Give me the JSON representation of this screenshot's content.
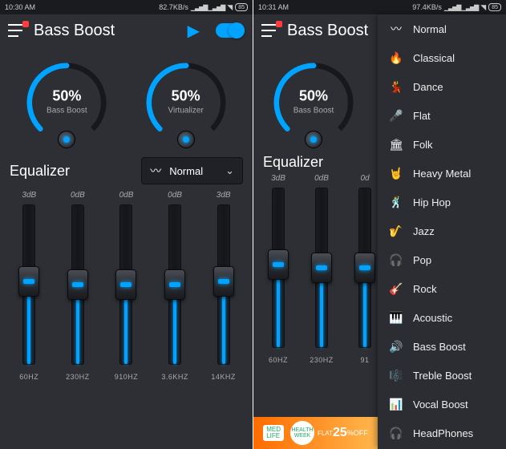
{
  "left": {
    "status": {
      "time": "10:30 AM",
      "net": "82.7KB/s",
      "battery": "85"
    },
    "title": "Bass Boost",
    "knobs": [
      {
        "percent": "50%",
        "label": "Bass Boost"
      },
      {
        "percent": "50%",
        "label": "Virtualizer"
      }
    ],
    "eq_title": "Equalizer",
    "preset_selected": "Normal",
    "bands": [
      {
        "db": "3dB",
        "freq": "60HZ",
        "pos": 52
      },
      {
        "db": "0dB",
        "freq": "230HZ",
        "pos": 50
      },
      {
        "db": "0dB",
        "freq": "910HZ",
        "pos": 50
      },
      {
        "db": "0dB",
        "freq": "3.6KHZ",
        "pos": 50
      },
      {
        "db": "3dB",
        "freq": "14KHZ",
        "pos": 52
      }
    ]
  },
  "right": {
    "status": {
      "time": "10:31 AM",
      "net": "97.4KB/s",
      "battery": "85"
    },
    "title": "Bass Boost",
    "knob": {
      "percent": "50%",
      "label": "Bass Boost"
    },
    "eq_title": "Equalizer",
    "bands": [
      {
        "db": "3dB",
        "freq": "60HZ",
        "pos": 52
      },
      {
        "db": "0dB",
        "freq": "230HZ",
        "pos": 50
      },
      {
        "db": "0d",
        "freq": "91",
        "pos": 50
      }
    ],
    "presets": [
      {
        "icon": "〰",
        "label": "Normal"
      },
      {
        "icon": "🔥",
        "label": "Classical"
      },
      {
        "icon": "💃",
        "label": "Dance"
      },
      {
        "icon": "🎤",
        "label": "Flat"
      },
      {
        "icon": "🏛",
        "label": "Folk"
      },
      {
        "icon": "🤘",
        "label": "Heavy Metal"
      },
      {
        "icon": "🕺",
        "label": "Hip Hop"
      },
      {
        "icon": "🎷",
        "label": "Jazz"
      },
      {
        "icon": "🎧",
        "label": "Pop"
      },
      {
        "icon": "🎸",
        "label": "Rock"
      },
      {
        "icon": "🎹",
        "label": "Acoustic"
      },
      {
        "icon": "🔊",
        "label": "Bass Boost"
      },
      {
        "icon": "🎼",
        "label": "Treble Boost"
      },
      {
        "icon": "📊",
        "label": "Vocal Boost"
      },
      {
        "icon": "🎧",
        "label": "HeadPhones"
      }
    ],
    "ad": {
      "brand1": "MED",
      "brand2": "LIFE",
      "circle": "HEALTH WEEK",
      "flat": "FLAT",
      "pct": "25",
      "off": "%OFF"
    }
  }
}
